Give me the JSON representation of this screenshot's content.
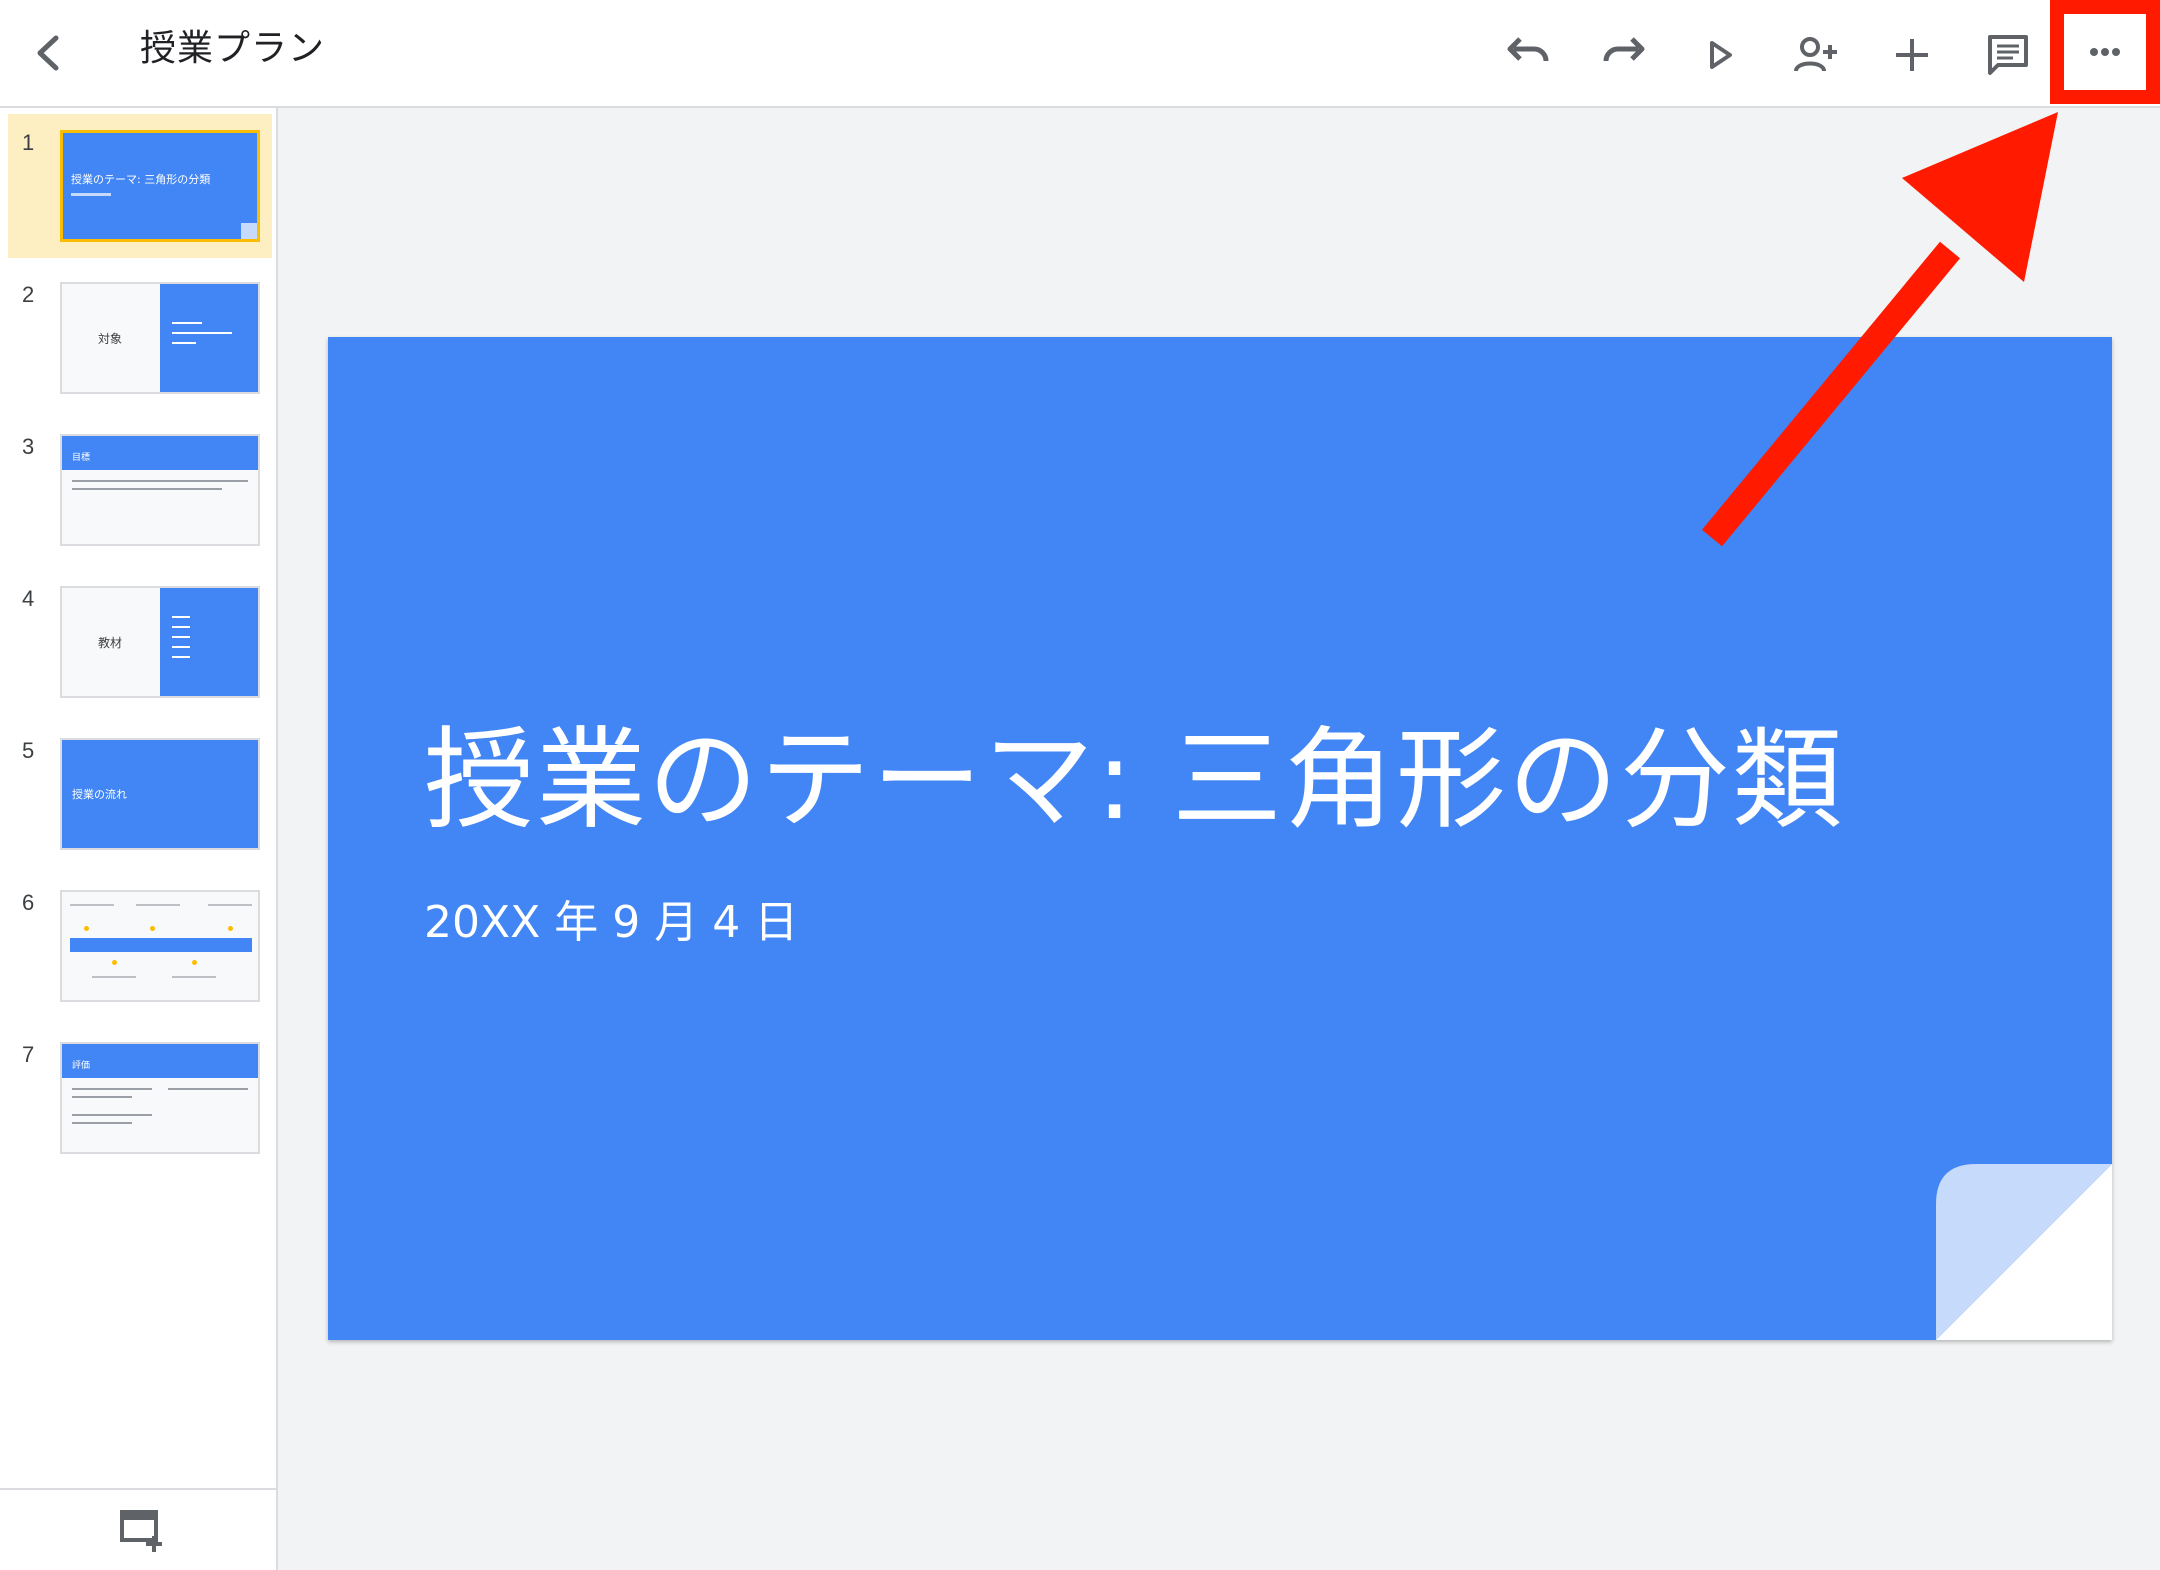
{
  "header": {
    "title": "授業プラン",
    "actions": [
      "undo-icon",
      "redo-icon",
      "play-icon",
      "add-person-icon",
      "plus-icon",
      "comment-icon",
      "more-icon"
    ]
  },
  "slides": [
    {
      "number": "1",
      "title": "授業のテーマ: 三角形の分類",
      "selected": true
    },
    {
      "number": "2",
      "title": "対象"
    },
    {
      "number": "3",
      "title": "目標"
    },
    {
      "number": "4",
      "title": "教材"
    },
    {
      "number": "5",
      "title": "授業の流れ"
    },
    {
      "number": "6",
      "title": ""
    },
    {
      "number": "7",
      "title": "評価"
    }
  ],
  "main_slide": {
    "title": "授業のテーマ: 三角形の分類",
    "subtitle": "20XX 年 9 月 4 日"
  },
  "colors": {
    "accent_blue": "#4285f4",
    "selection_bg": "#feefc3",
    "highlight_red": "#ff1a00"
  }
}
